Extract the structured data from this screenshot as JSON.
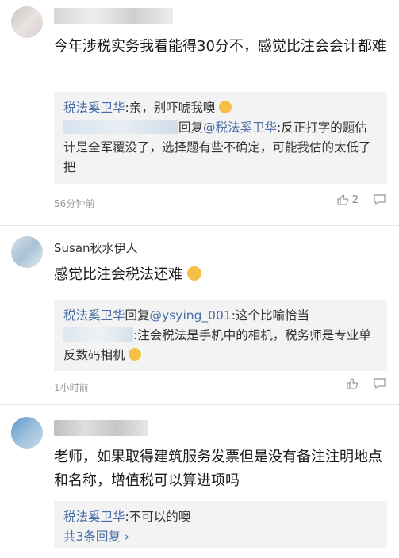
{
  "comments": [
    {
      "username": "",
      "text": "今年涉税实务我看能得30分不，感觉比注会会计都难",
      "replies_line1_author": "税法奚卫华",
      "replies_line1_text": ":亲，别吓唬我噢",
      "replies_line2_reply_label": "回复",
      "replies_line2_mention": "@税法奚卫华",
      "replies_line2_text": ":反正打字的题估计是全军覆没了，选择题有些不确定，可能我估的太低了把",
      "time": "56分钟前",
      "likes": "2"
    },
    {
      "username": "Susan秋水伊人",
      "text": "感觉比注会税法还难",
      "replies_line1_author": "税法奚卫华",
      "replies_line1_reply_label": "回复",
      "replies_line1_mention": "@ysying_001",
      "replies_line1_text": ":这个比喻恰当",
      "replies_line2_text": ":注会税法是手机中的相机，税务师是专业单反数码相机",
      "time": "1小时前"
    },
    {
      "username": "",
      "text": "老师，如果取得建筑服务发票但是没有备注注明地点和名称，增值税可以算进项吗",
      "replies_line1_author": "税法奚卫华",
      "replies_line1_text": ":不可以的噢",
      "more_replies": "共3条回复"
    }
  ],
  "icons": {
    "like": "thumbs-up-icon",
    "comment": "comment-bubble-icon",
    "emoji_laugh": "laugh-emoji-icon",
    "emoji_cry_laugh": "tears-of-joy-emoji-icon",
    "chevron": "chevron-right-icon"
  }
}
